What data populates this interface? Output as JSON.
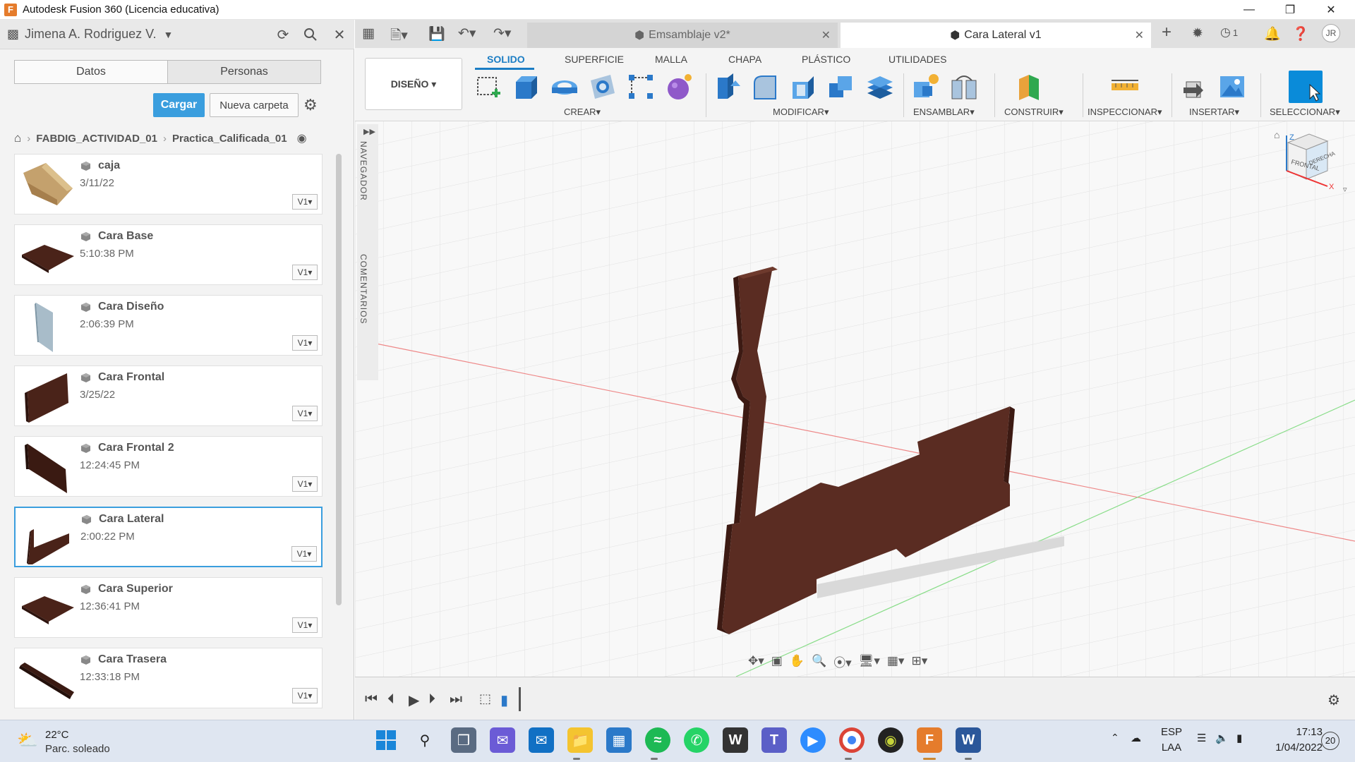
{
  "window": {
    "title": "Autodesk Fusion 360 (Licencia educativa)",
    "logo": "F"
  },
  "left_panel": {
    "user_name": "Jimena A. Rodriguez V.",
    "tabs": [
      "Datos",
      "Personas"
    ],
    "upload_label": "Cargar",
    "new_folder_label": "Nueva carpeta",
    "breadcrumb": [
      "FABDIG_ACTIVIDAD_01",
      "Practica_Calificada_01"
    ],
    "files": [
      {
        "name": "caja",
        "date": "3/11/22",
        "version": "V1"
      },
      {
        "name": "Cara Base",
        "date": "5:10:38 PM",
        "version": "V1"
      },
      {
        "name": "Cara Diseño",
        "date": "2:06:39 PM",
        "version": "V1"
      },
      {
        "name": "Cara Frontal",
        "date": "3/25/22",
        "version": "V1"
      },
      {
        "name": "Cara Frontal 2",
        "date": "12:24:45 PM",
        "version": "V1"
      },
      {
        "name": "Cara Lateral",
        "date": "2:00:22 PM",
        "version": "V1"
      },
      {
        "name": "Cara Superior",
        "date": "12:36:41 PM",
        "version": "V1"
      },
      {
        "name": "Cara Trasera",
        "date": "12:33:18 PM",
        "version": "V1"
      }
    ]
  },
  "doc_tabs": {
    "inactive": "Emsamblaje v2*",
    "active": "Cara Lateral v1",
    "job_count": "1",
    "user_initials": "JR"
  },
  "toolbar": {
    "workspace": "DISEÑO",
    "tabs": [
      "SOLIDO",
      "SUPERFICIE",
      "MALLA",
      "CHAPA",
      "PLÁSTICO",
      "UTILIDADES"
    ],
    "groups": [
      "CREAR",
      "MODIFICAR",
      "ENSAMBLAR",
      "CONSTRUIR",
      "INSPECCIONAR",
      "INSERTAR",
      "SELECCIONAR"
    ]
  },
  "viewport": {
    "side_labels": [
      "NAVEGADOR",
      "COMENTARIOS"
    ],
    "viewcube": {
      "front": "FRONTAL",
      "right": "DERECHA",
      "axis_x": "X",
      "axis_z": "Z"
    }
  },
  "taskbar": {
    "weather_temp": "22°C",
    "weather_desc": "Parc. soleado",
    "lang": "ESP",
    "lang_sub": "LAA",
    "time": "17:13",
    "date": "1/04/2022",
    "notif_count": "20"
  },
  "colors": {
    "accent": "#3a9ede",
    "wood": "#5a2c22",
    "fusion_orange": "#e57c2c"
  }
}
